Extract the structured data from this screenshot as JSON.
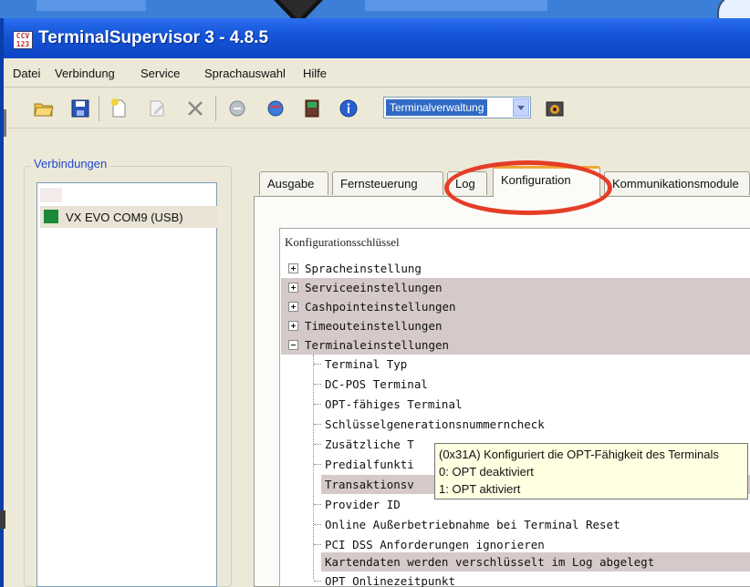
{
  "window": {
    "title": "TerminalSupervisor 3 - 4.8.5"
  },
  "menu": [
    "Datei",
    "Verbindung",
    "Service",
    "Sprachauswahl",
    "Hilfe"
  ],
  "toolbar": {
    "icons": [
      "open-folder",
      "save",
      "new",
      "edit",
      "delete",
      "disconnect",
      "connect",
      "terminal",
      "info",
      "terminal-tool"
    ],
    "combo_value": "Terminalverwaltung"
  },
  "connections": {
    "label": "Verbindungen",
    "items": [
      {
        "label": "VX EVO COM9 (USB)",
        "status_color": "#1a8a3a"
      }
    ]
  },
  "tabs": [
    {
      "label": "Ausgabe",
      "active": false
    },
    {
      "label": "Fernsteuerung",
      "active": false
    },
    {
      "label": "Log",
      "active": false
    },
    {
      "label": "Konfiguration",
      "active": true
    },
    {
      "label": "Kommunikationsmodule",
      "active": false
    }
  ],
  "config": {
    "header": "Konfigurationsschlüssel",
    "top_nodes": [
      {
        "label": "Spracheinstellung",
        "expanded": false,
        "shaded": false
      },
      {
        "label": "Serviceeinstellungen",
        "expanded": false,
        "shaded": true
      },
      {
        "label": "Cashpointeinstellungen",
        "expanded": false,
        "shaded": true
      },
      {
        "label": "Timeouteinstellungen",
        "expanded": false,
        "shaded": true
      },
      {
        "label": "Terminaleinstellungen",
        "expanded": true,
        "shaded": true
      }
    ],
    "children": [
      {
        "label": "Terminal Typ",
        "shaded": false
      },
      {
        "label": "DC-POS Terminal",
        "shaded": false
      },
      {
        "label": "OPT-fähiges Terminal",
        "shaded": false
      },
      {
        "label": "Schlüsselgenerationsnummerncheck",
        "shaded": false
      },
      {
        "label": "Zusätzliche T",
        "shaded": false
      },
      {
        "label": "Predialfunkti",
        "shaded": false
      },
      {
        "label": "Transaktionsv",
        "shaded": true
      },
      {
        "label": "Provider ID",
        "shaded": false
      },
      {
        "label": "Online Außerbetriebnahme bei Terminal Reset",
        "shaded": false
      },
      {
        "label": "PCI DSS Anforderungen ignorieren",
        "shaded": false
      },
      {
        "label": "Kartendaten werden verschlüsselt im Log abgelegt",
        "shaded": true
      },
      {
        "label": "OPT Onlinezeitpunkt",
        "shaded": false
      }
    ]
  },
  "tooltip": {
    "lines": [
      "(0x31A) Konfiguriert die OPT-Fähigkeit des Terminals",
      "0: OPT deaktiviert",
      "1: OPT aktiviert"
    ]
  },
  "colors": {
    "accent": "#e43d28",
    "title_bar": "#0b44c4",
    "row_shade": "#d6c9c9",
    "tooltip_bg": "#ffffe1"
  }
}
